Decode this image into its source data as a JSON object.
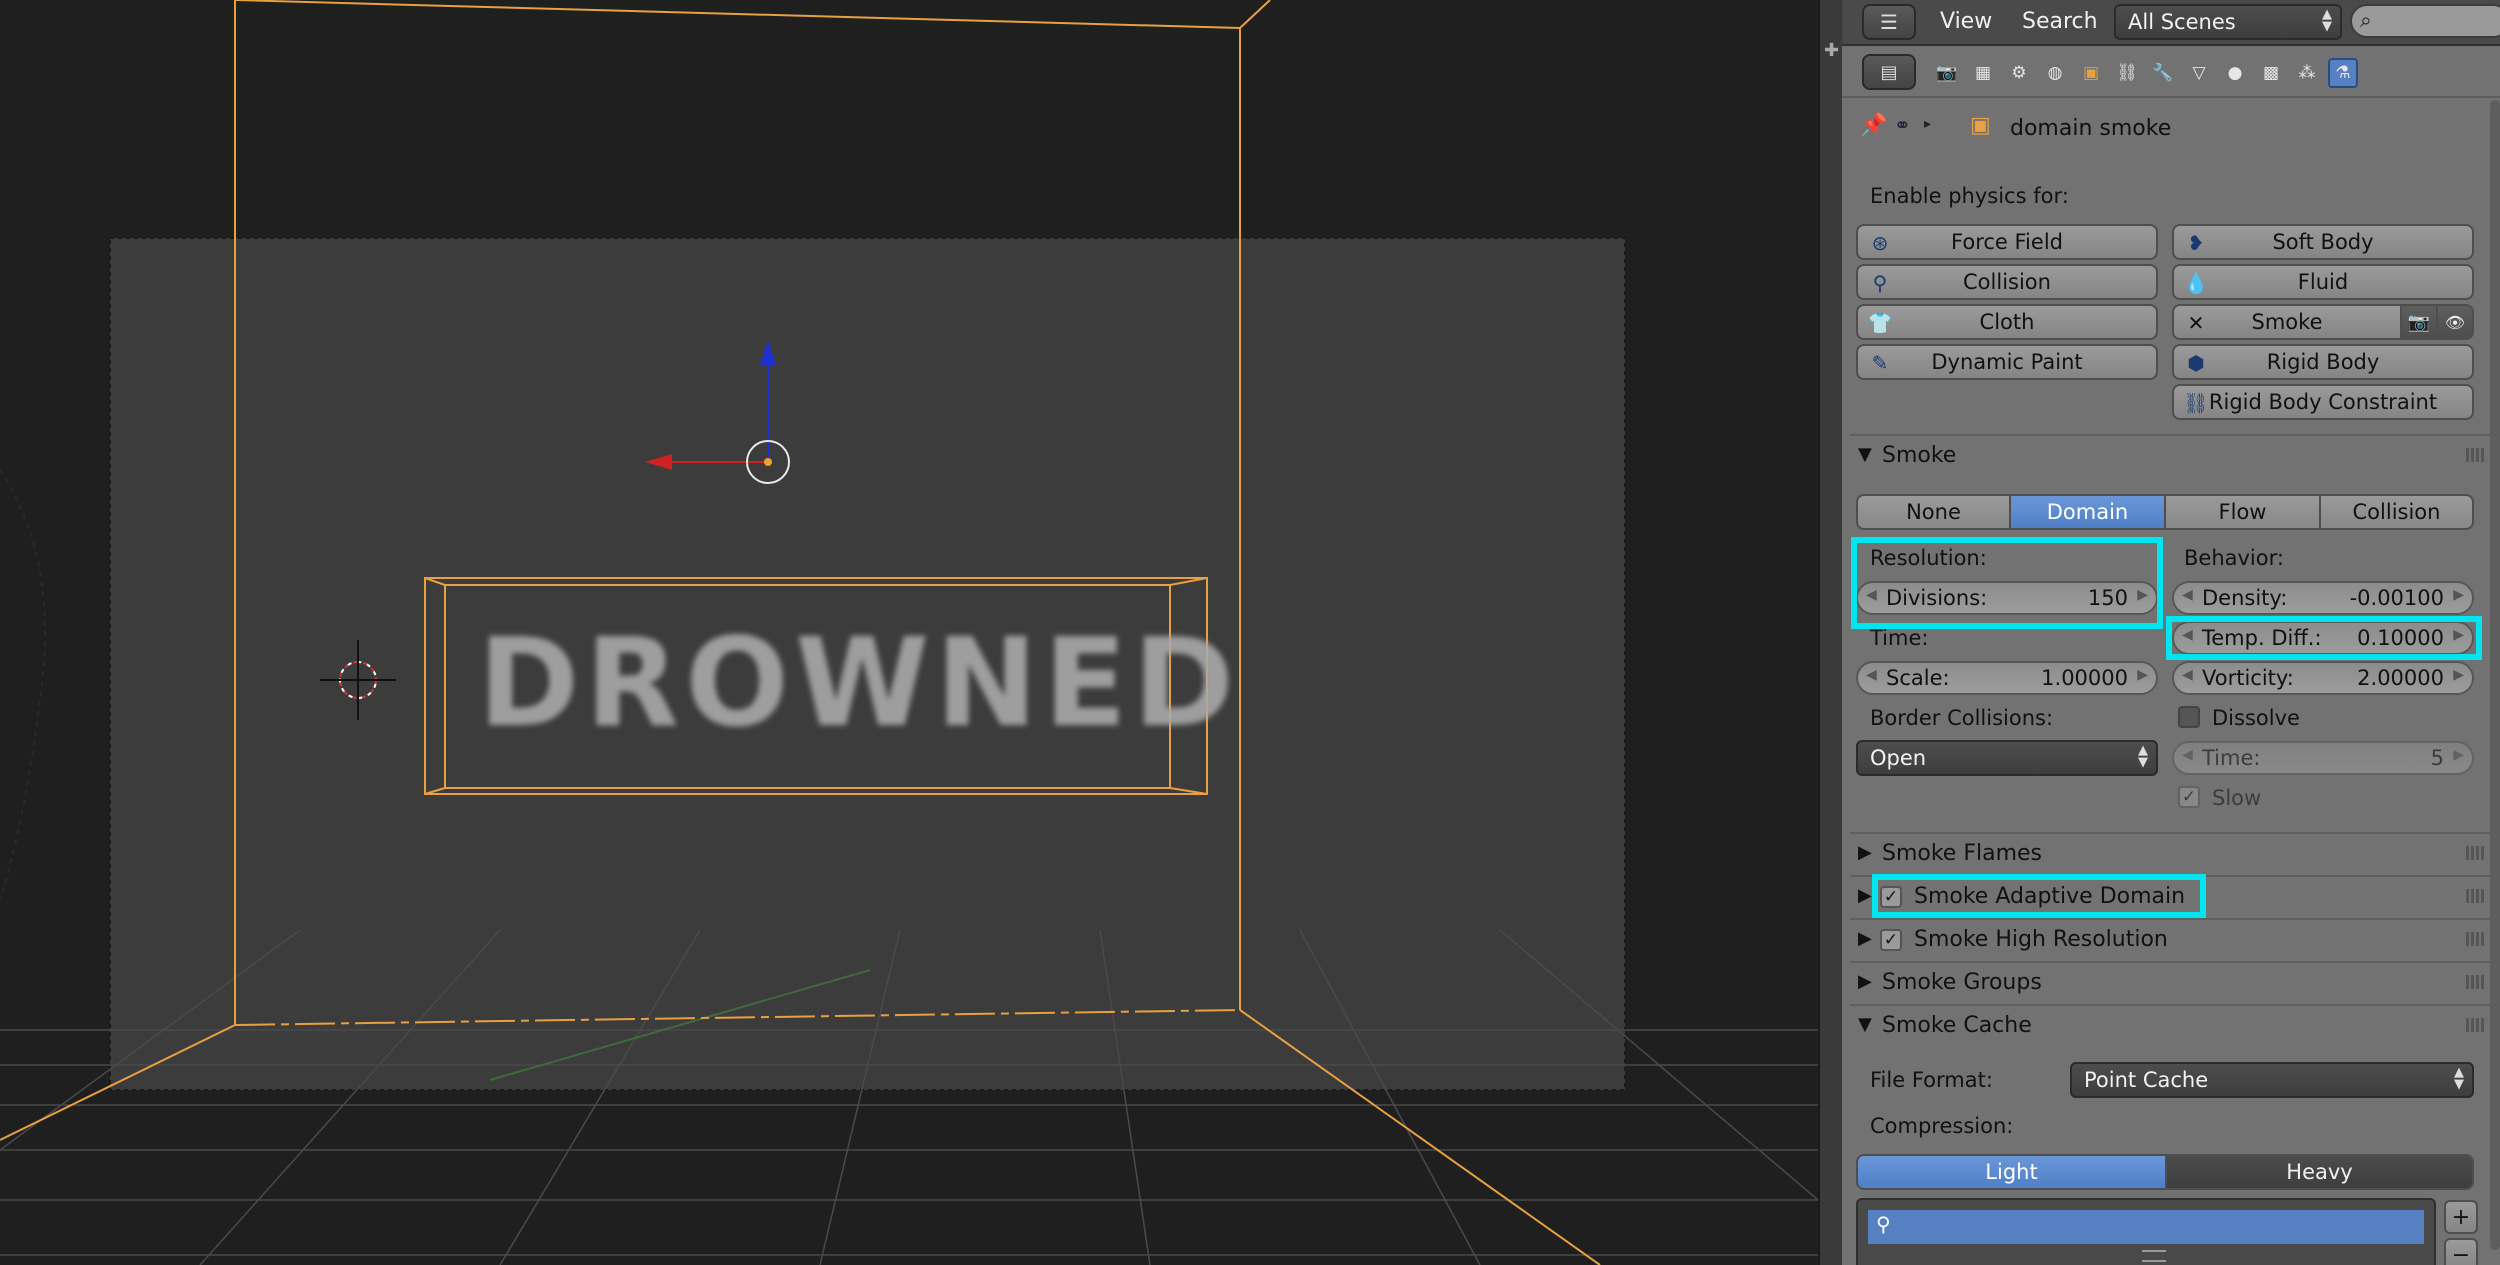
{
  "viewport": {
    "overlay_text": "DROWNED"
  },
  "header": {
    "menu_view": "View",
    "menu_search": "Search",
    "scene_select": "All Scenes",
    "search_icon": "magnifier-icon"
  },
  "context": {
    "object_name": "domain smoke"
  },
  "physics": {
    "enable_label": "Enable physics for:",
    "left": [
      "Force Field",
      "Collision",
      "Cloth",
      "Dynamic Paint"
    ],
    "right": [
      "Soft Body",
      "Fluid",
      "Smoke",
      "Rigid Body",
      "Rigid Body Constraint"
    ]
  },
  "smoke": {
    "title": "Smoke",
    "tabs": [
      "None",
      "Domain",
      "Flow",
      "Collision"
    ],
    "active_tab": "Domain",
    "resolution_label": "Resolution:",
    "divisions_label": "Divisions:",
    "divisions_value": "150",
    "time_label": "Time:",
    "scale_label": "Scale:",
    "scale_value": "1.00000",
    "border_label": "Border Collisions:",
    "border_value": "Open",
    "behavior_label": "Behavior:",
    "density_label": "Density:",
    "density_value": "-0.00100",
    "temp_label": "Temp. Diff.:",
    "temp_value": "0.10000",
    "vorticity_label": "Vorticity:",
    "vorticity_value": "2.00000",
    "dissolve_label": "Dissolve",
    "dissolve_time_label": "Time:",
    "dissolve_time_value": "5",
    "slow_label": "Slow"
  },
  "subpanels": {
    "flames": "Smoke Flames",
    "adaptive": "Smoke Adaptive Domain",
    "highres": "Smoke High Resolution",
    "groups": "Smoke Groups",
    "cache": "Smoke Cache"
  },
  "cache": {
    "file_format_label": "File Format:",
    "file_format_value": "Point Cache",
    "compression_label": "Compression:",
    "light": "Light",
    "heavy": "Heavy"
  },
  "colors": {
    "accent": "#5680c2",
    "highlight": "#00e5ee",
    "object_orange": "#e8a040"
  }
}
